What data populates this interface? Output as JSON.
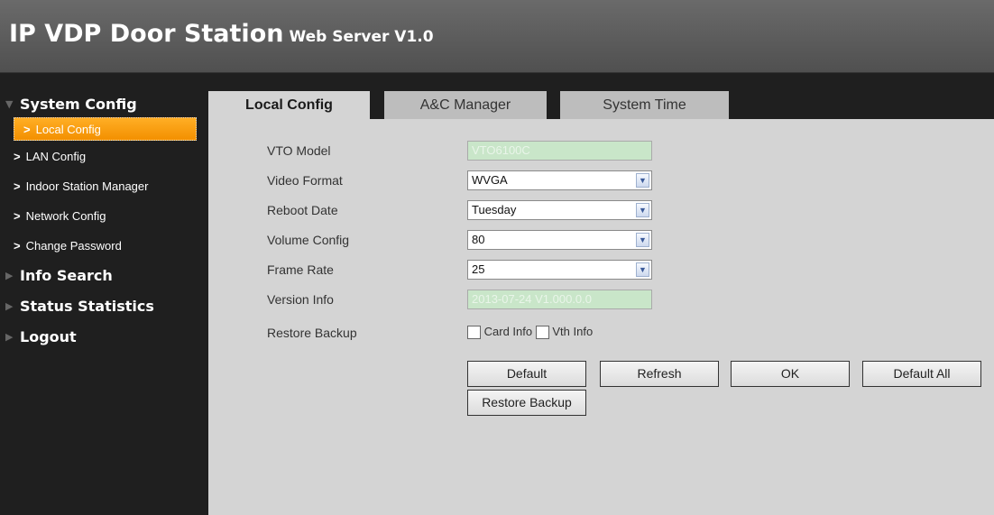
{
  "header": {
    "title": "IP VDP Door Station",
    "subtitle": "Web Server V1.0"
  },
  "sidebar": {
    "system_config": "System Config",
    "items": [
      "Local Config",
      "LAN Config",
      "Indoor Station Manager",
      "Network Config",
      "Change Password"
    ],
    "info_search": "Info Search",
    "status_statistics": "Status Statistics",
    "logout": "Logout"
  },
  "tabs": [
    "Local Config",
    "A&C Manager",
    "System Time"
  ],
  "form": {
    "vto_model_label": "VTO Model",
    "vto_model_value": "VTO6100C",
    "video_format_label": "Video Format",
    "video_format_value": "WVGA",
    "reboot_date_label": "Reboot Date",
    "reboot_date_value": "Tuesday",
    "volume_config_label": "Volume Config",
    "volume_config_value": "80",
    "frame_rate_label": "Frame Rate",
    "frame_rate_value": "25",
    "version_info_label": "Version Info",
    "version_info_value": "2013-07-24 V1.000.0.0",
    "restore_backup_label": "Restore Backup",
    "card_info_label": "Card Info",
    "vth_info_label": "Vth Info"
  },
  "buttons": {
    "default": "Default",
    "refresh": "Refresh",
    "ok": "OK",
    "default_all": "Default All",
    "restore_backup": "Restore Backup"
  },
  "colors": {
    "accent": "#f39000",
    "panel": "#d4d4d4",
    "header": "#5a5a5a"
  }
}
